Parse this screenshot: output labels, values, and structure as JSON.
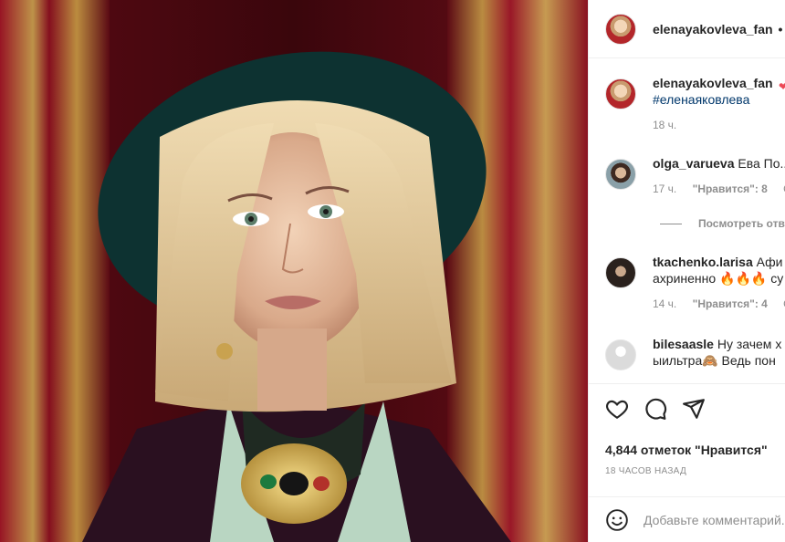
{
  "post": {
    "photo_description_icon": "portrait-photo",
    "author": "elenayakovleva_fan",
    "header_dot": "•"
  },
  "caption": {
    "username": "elenayakovleva_fan",
    "hashtag": "#еленаяковлева",
    "time": "18 ч."
  },
  "comments": [
    {
      "username": "olga_varueva",
      "text": "Ева По...",
      "time": "17 ч.",
      "likes": "\"Нравится\": 8",
      "reply": "О"
    },
    {
      "username": "tkachenko.larisa",
      "text": "Афи",
      "text2": "ахриненно 🔥🔥🔥 су",
      "time": "14 ч.",
      "likes": "\"Нравится\": 4",
      "reply": "О"
    },
    {
      "username": "bilesaasle",
      "text": "Ну зачем х",
      "text2": "ыильтра🙈 Ведь пон"
    }
  ],
  "view_replies": "Посмотреть отв",
  "actions": {
    "likes": "4,844 отметок \"Нравится\"",
    "time": "18 ЧАСОВ НАЗАД"
  },
  "add_comment": {
    "placeholder": "Добавьте комментарий..."
  },
  "colors": {
    "curtain": "#7d0f1c",
    "hat": "#0f3a3a",
    "hair": "#e2c99a",
    "link": "#00376b",
    "secondary_text": "#8e8e8e"
  }
}
